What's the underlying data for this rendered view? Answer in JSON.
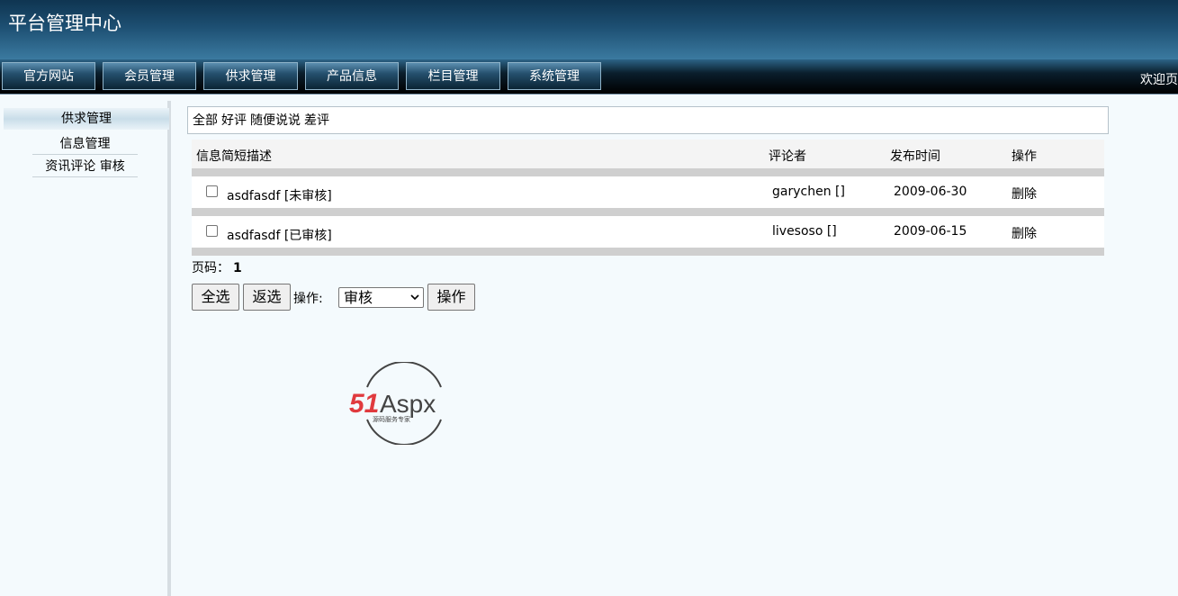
{
  "header": {
    "title": "平台管理中心"
  },
  "nav": {
    "items": [
      "官方网站",
      "会员管理",
      "供求管理",
      "产品信息",
      "栏目管理",
      "系统管理"
    ],
    "welcome": "欢迎页"
  },
  "sidebar": {
    "title": "供求管理",
    "items": [
      "信息管理",
      "资讯评论 审核"
    ]
  },
  "filters": [
    "全部",
    "好评",
    "随便说说",
    "差评"
  ],
  "table": {
    "headers": [
      "信息简短描述",
      "评论者",
      "发布时间",
      "操作"
    ],
    "rows": [
      {
        "desc": "asdfasdf [未审核]",
        "author": "garychen []",
        "date": "2009-06-30",
        "action": "删除"
      },
      {
        "desc": "asdfasdf [已审核]",
        "author": "livesoso []",
        "date": "2009-06-15",
        "action": "删除"
      }
    ]
  },
  "pager": {
    "label": "页码：",
    "page": "1"
  },
  "ops": {
    "select_all": "全选",
    "invert": "返选",
    "label": "操作:",
    "selected": "审核",
    "submit": "操作"
  },
  "logo": {
    "brand": "51Aspx",
    "tagline": "源码服务专家"
  },
  "colors": {
    "logo_red": "#e03a3e",
    "logo_green": "#3aa63f",
    "logo_gray": "#444444"
  }
}
